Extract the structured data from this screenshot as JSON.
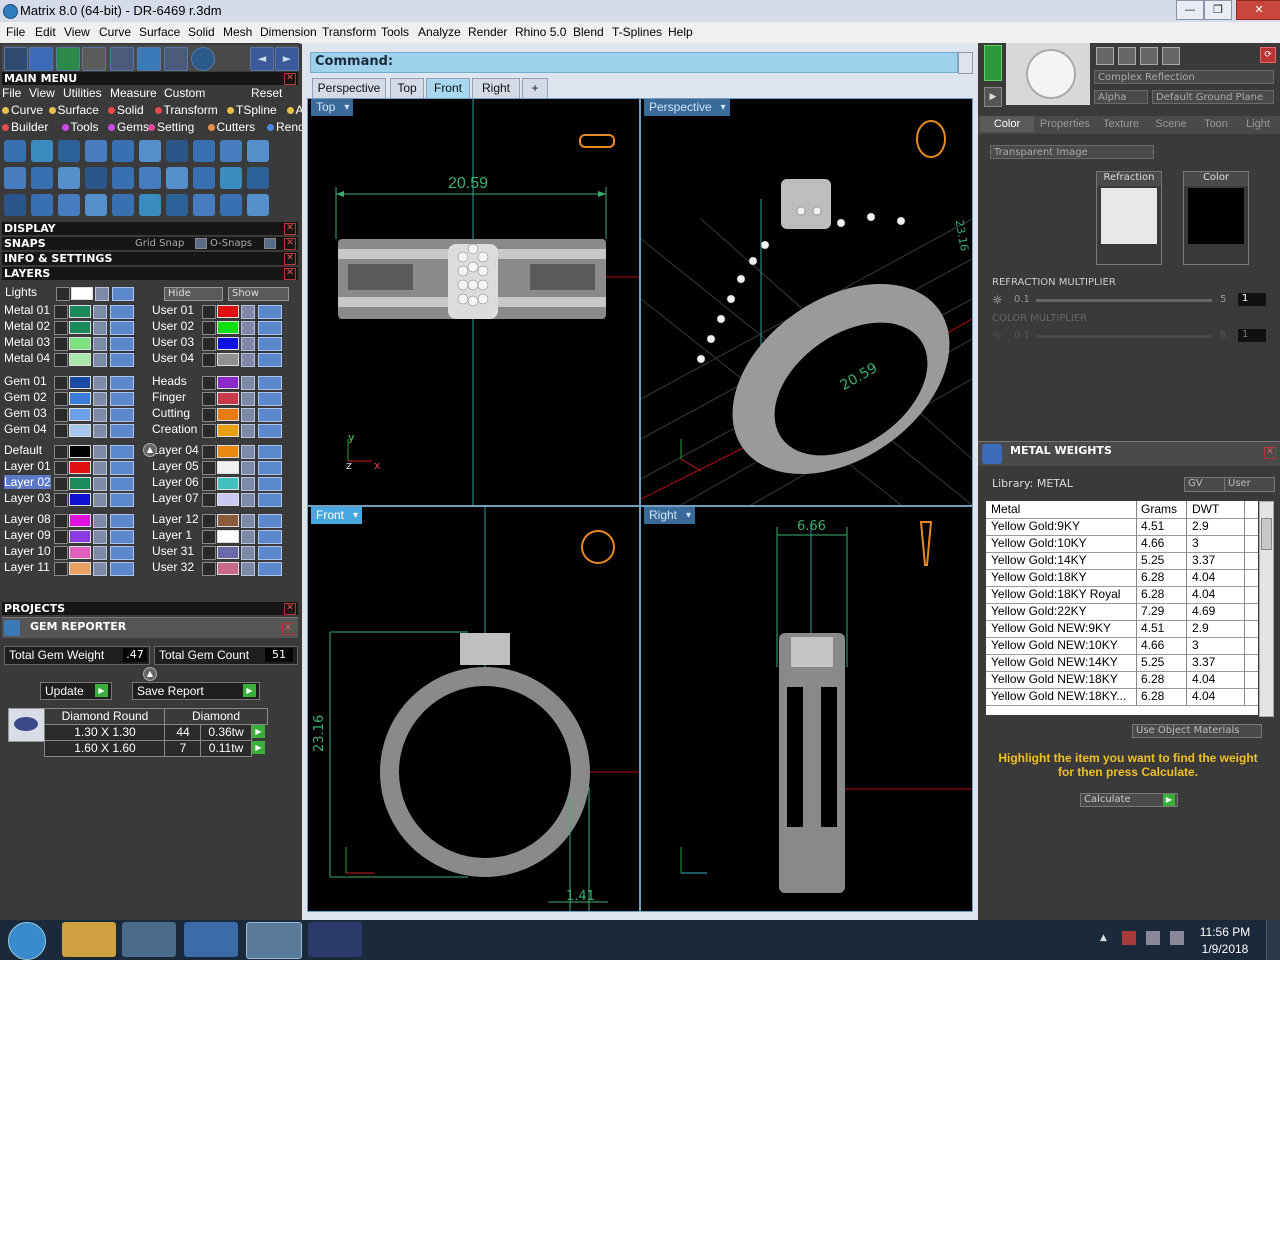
{
  "window": {
    "title": "Matrix 8.0 (64-bit) - DR-6469 r.3dm",
    "minimize": "—",
    "maximize": "❐",
    "close": "✕"
  },
  "menubar": [
    "File",
    "Edit",
    "View",
    "Curve",
    "Surface",
    "Solid",
    "Mesh",
    "Dimension",
    "Transform",
    "Tools",
    "Analyze",
    "Render",
    "Rhino 5.0",
    "Blend",
    "T-Splines",
    "Help"
  ],
  "left": {
    "main_menu_title": "MAIN MENU",
    "menu_row": [
      "File",
      "View",
      "Utilities",
      "Measure",
      "Custom",
      "Reset"
    ],
    "category_row1": [
      {
        "label": "Curve",
        "color": "#e8c04a"
      },
      {
        "label": "Surface",
        "color": "#e8c04a"
      },
      {
        "label": "Solid",
        "color": "#e84a4a"
      },
      {
        "label": "Transform",
        "color": "#e84a4a"
      },
      {
        "label": "TSpline",
        "color": "#e8c04a"
      },
      {
        "label": "Art",
        "color": "#e8c04a"
      }
    ],
    "category_row2": [
      {
        "label": "Builder",
        "color": "#e84a4a"
      },
      {
        "label": "Tools",
        "color": "#c84ae8"
      },
      {
        "label": "Gems",
        "color": "#c84ae8"
      },
      {
        "label": "Setting",
        "color": "#e84a9a"
      },
      {
        "label": "Cutters",
        "color": "#e8904a"
      },
      {
        "label": "Render",
        "color": "#4a8ae8"
      }
    ],
    "display_title": "DISPLAY",
    "snaps_title": "SNAPS",
    "grid_snap": "Grid Snap",
    "o_snaps": "O-Snaps",
    "info_title": "INFO & SETTINGS",
    "layers_title": "LAYERS",
    "lights_label": "Lights",
    "hide_label": "Hide",
    "show_label": "Show",
    "layers_left": [
      {
        "name": "Metal 01",
        "color": "#1a8a5a"
      },
      {
        "name": "Metal 02",
        "color": "#1a8a5a"
      },
      {
        "name": "Metal 03",
        "color": "#7fe07f"
      },
      {
        "name": "Metal 04",
        "color": "#a8e8a8"
      },
      {
        "name": "Gem 01",
        "color": "#1a4aa8"
      },
      {
        "name": "Gem 02",
        "color": "#3a7ad8"
      },
      {
        "name": "Gem 03",
        "color": "#6aa0e8"
      },
      {
        "name": "Gem 04",
        "color": "#a8c8f0"
      },
      {
        "name": "Default",
        "color": "#000000"
      },
      {
        "name": "Layer 01",
        "color": "#e01010"
      },
      {
        "name": "Layer 02",
        "color": "#1a8a5a"
      },
      {
        "name": "Layer 03",
        "color": "#1010d0"
      },
      {
        "name": "Layer 08",
        "color": "#e010e0"
      },
      {
        "name": "Layer 09",
        "color": "#8a3ae0"
      },
      {
        "name": "Layer 10",
        "color": "#e060c0"
      },
      {
        "name": "Layer 11",
        "color": "#e8a060"
      }
    ],
    "layers_right": [
      {
        "name": "User 01",
        "color": "#e01010"
      },
      {
        "name": "User 02",
        "color": "#10e010"
      },
      {
        "name": "User 03",
        "color": "#1010e0"
      },
      {
        "name": "User 04",
        "color": "#909090"
      },
      {
        "name": "Heads",
        "color": "#8a2ac8"
      },
      {
        "name": "Finger",
        "color": "#c83a4a"
      },
      {
        "name": "Cutting",
        "color": "#e87a10"
      },
      {
        "name": "Creation",
        "color": "#e8a010"
      },
      {
        "name": "Layer 04",
        "color": "#e88a10"
      },
      {
        "name": "Layer 05",
        "color": "#f0f0f0"
      },
      {
        "name": "Layer 06",
        "color": "#40c0c0"
      },
      {
        "name": "Layer 07",
        "color": "#c8c8f0"
      },
      {
        "name": "Layer 12",
        "color": "#8a5a3a"
      },
      {
        "name": "Layer 1",
        "color": "#ffffff"
      },
      {
        "name": "User 31",
        "color": "#6a6aa8"
      },
      {
        "name": "User 32",
        "color": "#c86a8a"
      }
    ],
    "projects_title": "PROJECTS",
    "gem_reporter_title": "GEM REPORTER",
    "total_gem_weight_label": "Total Gem Weight",
    "total_gem_weight": ".47",
    "total_gem_count_label": "Total Gem Count",
    "total_gem_count": "51",
    "update_label": "Update",
    "save_report_label": "Save Report",
    "gem_table": {
      "headers": [
        "Diamond Round",
        "Diamond"
      ],
      "rows": [
        {
          "size": "1.30 X 1.30",
          "count": "44",
          "weight": "0.36tw"
        },
        {
          "size": "1.60 X 1.60",
          "count": "7",
          "weight": "0.11tw"
        }
      ]
    }
  },
  "center": {
    "command_label": "Command:",
    "tabs": [
      "Perspective",
      "Top",
      "Front",
      "Right",
      "+"
    ],
    "active_tab": "Front",
    "viewports": {
      "top": {
        "label": "Top",
        "dimension": "20.59"
      },
      "perspective": {
        "label": "Perspective",
        "dimension_a": "20.59",
        "dimension_b": "23.16"
      },
      "front": {
        "label": "Front",
        "dimension_a": "23.16",
        "dimension_b": "1.41"
      },
      "right": {
        "label": "Right",
        "dimension": "6.66"
      }
    },
    "axis_labels": {
      "x": "x",
      "y": "y",
      "z": "z"
    }
  },
  "right": {
    "render_mode": "Complex Reflection",
    "alpha_label": "Alpha",
    "ground_plane": "Default Ground Plane",
    "tabs": [
      "Color",
      "Properties",
      "Texture",
      "Scene",
      "Toon",
      "Light"
    ],
    "active_tab": "Color",
    "transparency_combo": "Transparent Image",
    "refraction_label": "Refraction",
    "color_label": "Color",
    "refraction_multiplier_label": "REFRACTION MULTIPLIER",
    "refraction_min": "0.1",
    "refraction_max": "5",
    "refraction_value": "1",
    "color_multiplier_label": "COLOR MULTIPLIER",
    "color_min": "0.1",
    "color_max": "5",
    "color_value": "1",
    "metal_weights_title": "METAL WEIGHTS",
    "library_label": "Library: METAL",
    "gv_label": "GV",
    "user_label": "User",
    "metal_headers": [
      "Metal",
      "Grams",
      "DWT"
    ],
    "metal_rows": [
      [
        "Yellow Gold:9KY",
        "4.51",
        "2.9"
      ],
      [
        "Yellow Gold:10KY",
        "4.66",
        "3"
      ],
      [
        "Yellow Gold:14KY",
        "5.25",
        "3.37"
      ],
      [
        "Yellow Gold:18KY",
        "6.28",
        "4.04"
      ],
      [
        "Yellow Gold:18KY Royal",
        "6.28",
        "4.04"
      ],
      [
        "Yellow Gold:22KY",
        "7.29",
        "4.69"
      ],
      [
        "Yellow Gold NEW:9KY",
        "4.51",
        "2.9"
      ],
      [
        "Yellow Gold NEW:10KY",
        "4.66",
        "3"
      ],
      [
        "Yellow Gold NEW:14KY",
        "5.25",
        "3.37"
      ],
      [
        "Yellow Gold NEW:18KY",
        "6.28",
        "4.04"
      ],
      [
        "Yellow Gold NEW:18KY...",
        "6.28",
        "4.04"
      ]
    ],
    "use_object_materials": "Use Object Materials",
    "instruction": "Highlight the item you want to find the weight for then press Calculate.",
    "calculate_label": "Calculate"
  },
  "taskbar": {
    "time": "11:56 PM",
    "date": "1/9/2018",
    "tray_arrow": "▲"
  }
}
